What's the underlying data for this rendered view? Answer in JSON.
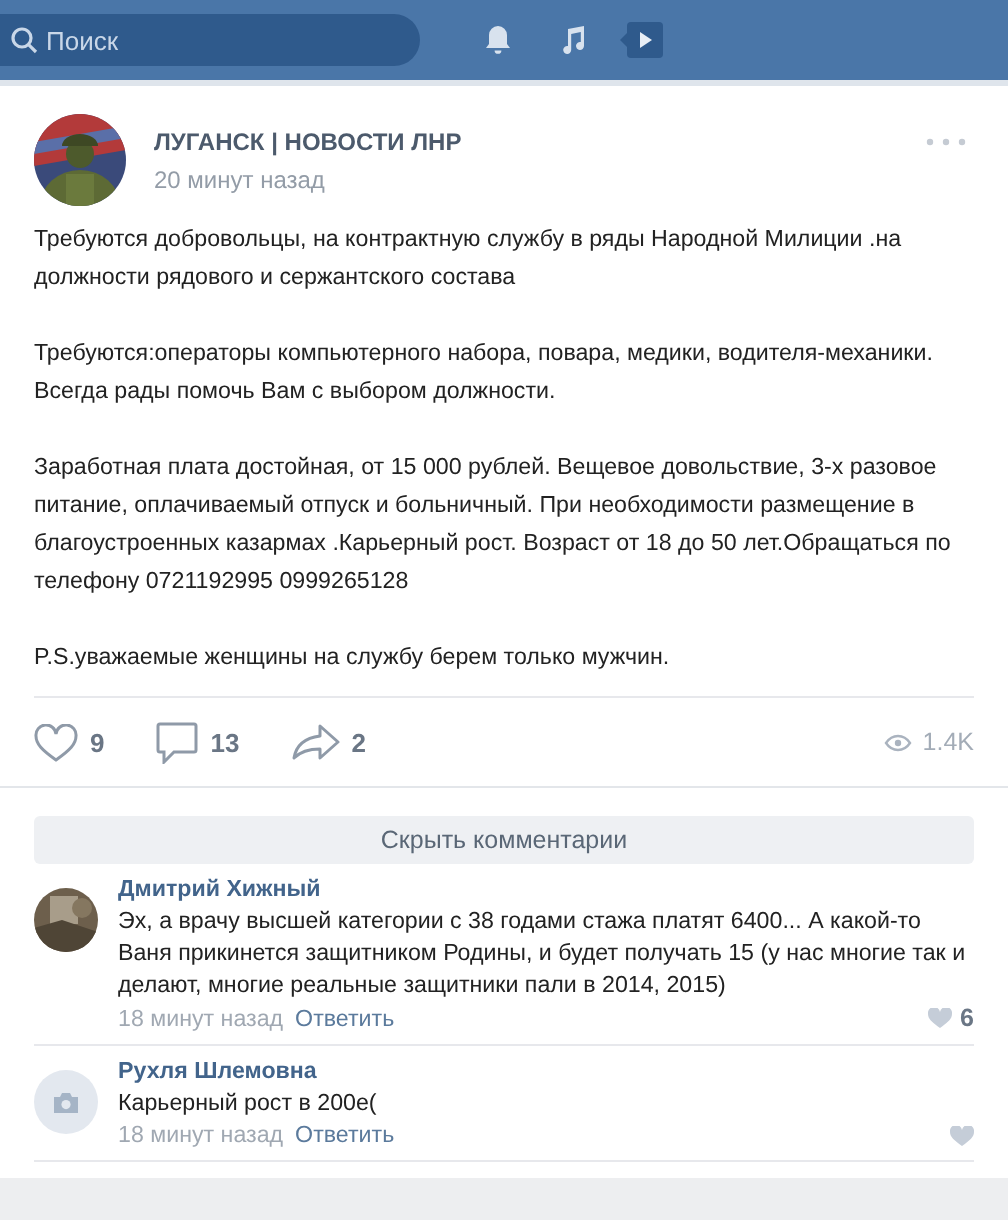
{
  "top_bar": {
    "search": {
      "placeholder": "Поиск"
    }
  },
  "post": {
    "author": "ЛУГАНСК | НОВОСТИ ЛНР",
    "time": "20 минут назад",
    "paragraphs": [
      [
        "Требуются добровольцы, на контрактную службу в ряды Народной Милиции .на должности рядового и сержантского состава"
      ],
      [
        "Требуются:операторы компьютерного набора, повара, медики, водителя-механики.",
        "Всегда рады помочь Вам с выбором должности."
      ],
      [
        "Заработная плата достойная, от 15 000 рублей. Вещевое довольствие, 3-х разовое питание, оплачиваемый отпуск и больничный. При необходимости размещение в благоустроенных казармах .Карьерный рост. Возраст от 18 до 50 лет.Обращаться по телефону 0721192995 0999265128"
      ],
      [
        "P.S.уважаемые женщины на службу берем только мужчин."
      ]
    ],
    "likes": "9",
    "comments": "13",
    "shares": "2",
    "views": "1.4K"
  },
  "hide_comments_button": "Скрыть комментарии",
  "comments": [
    {
      "author": "Дмитрий Хижный",
      "text": "Эх, а врачу высшей категории с 38 годами стажа платят 6400... А какой-то Ваня прикинется защитником Родины, и будет получать 15 (у нас многие так и делают, многие реальные защитники пали в 2014, 2015)",
      "time": "18 минут назад",
      "reply": "Ответить",
      "likes": "6"
    },
    {
      "avatar": {
        "kind": "placeholder"
      },
      "author": "Рухля Шлемовна",
      "text": "Карьерный рост в 200е(",
      "time": "18 минут назад",
      "reply": "Ответить"
    }
  ]
}
